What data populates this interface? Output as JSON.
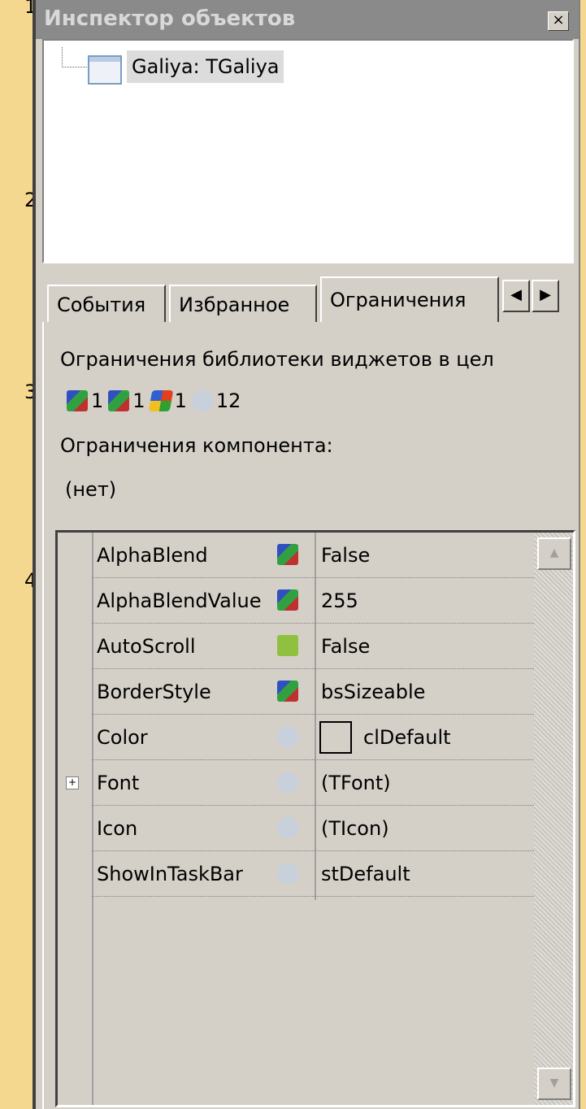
{
  "ruler": [
    "1",
    "2",
    "3",
    "4"
  ],
  "window": {
    "title": "Инспектор объектов",
    "close_glyph": "×"
  },
  "tree": {
    "node_label": "Galiya: TGaliya"
  },
  "tabs": [
    {
      "label": "События"
    },
    {
      "label": "Избранное"
    },
    {
      "label": "Ограничения"
    }
  ],
  "tab_scroll": {
    "left": "◀",
    "right": "▶"
  },
  "restrictions": {
    "widgetset_heading": "Ограничения библиотеки виджетов в цел",
    "counts": [
      {
        "icon": "gtk1-cube-icon",
        "count": "1"
      },
      {
        "icon": "gtk2-cube-icon",
        "count": "1"
      },
      {
        "icon": "win32-icon",
        "count": "1"
      },
      {
        "icon": "carbon-icon",
        "count": "12"
      }
    ],
    "component_heading": "Ограничения компонента:",
    "component_value": "(нет)"
  },
  "properties": [
    {
      "name": "AlphaBlend",
      "icon": "gtk1-cube-icon",
      "value": "False"
    },
    {
      "name": "AlphaBlendValue",
      "icon": "gtk1-cube-icon",
      "value": "255"
    },
    {
      "name": "AutoScroll",
      "icon": "qt-icon",
      "value": "False"
    },
    {
      "name": "BorderStyle",
      "icon": "gtk2-cube-icon",
      "value": "bsSizeable"
    },
    {
      "name": "Color",
      "icon": "carbon-icon",
      "value": "clDefault"
    },
    {
      "name": "Font",
      "icon": "carbon-icon",
      "value": "(TFont)",
      "expandable": true
    },
    {
      "name": "Icon",
      "icon": "carbon-icon",
      "value": "(TIcon)"
    },
    {
      "name": "ShowInTaskBar",
      "icon": "carbon-icon",
      "value": "stDefault"
    }
  ],
  "expand_glyph": "+",
  "scroll": {
    "up": "▲",
    "down": "▼"
  }
}
